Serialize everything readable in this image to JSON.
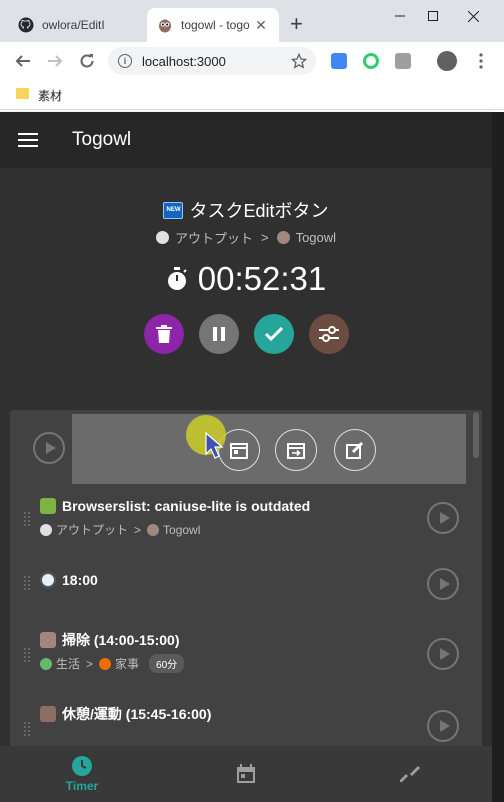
{
  "browser": {
    "tabs": [
      {
        "title": "owlora/EditI",
        "active": false
      },
      {
        "title": "togowl - togo",
        "active": true
      }
    ],
    "url": "localhost:3000",
    "bookmarks": [
      {
        "label": "素材"
      }
    ]
  },
  "app": {
    "title": "Togowl"
  },
  "current_task": {
    "badge": "NEW",
    "title": "タスクEditボタン",
    "project": "アウトプット",
    "separator": ">",
    "client": "Togowl",
    "elapsed": "00:52:31"
  },
  "actions": [
    {
      "name": "delete",
      "color": "#8e24aa"
    },
    {
      "name": "pause",
      "color": "#757575"
    },
    {
      "name": "complete",
      "color": "#26a69a"
    },
    {
      "name": "settings",
      "color": "#6d4c41"
    }
  ],
  "entries": [
    {
      "title": "Browserslist: caniuse-lite is outdated",
      "project": "アウトプット",
      "client": "Togowl",
      "icon": "caterpillar-icon"
    },
    {
      "title": "18:00",
      "icon": "clock-icon"
    },
    {
      "title": "掃除 (14:00-15:00)",
      "project": "生活",
      "client": "家事",
      "estimate": "60分",
      "icon": "broom-icon"
    },
    {
      "title": "休憩/運動 (15:45-16:00)",
      "icon": "deer-icon"
    }
  ],
  "bottom_nav": [
    {
      "label": "Timer",
      "active": true
    },
    {
      "label": "",
      "active": false
    },
    {
      "label": "",
      "active": false
    }
  ]
}
